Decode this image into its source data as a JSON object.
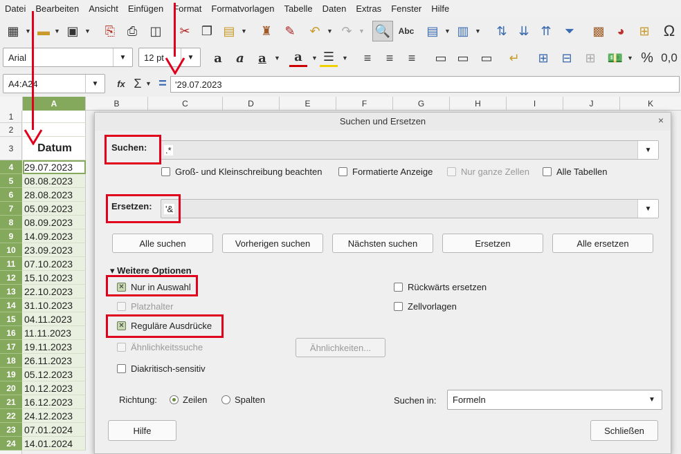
{
  "menu": [
    "Datei",
    "Bearbeiten",
    "Ansicht",
    "Einfügen",
    "Format",
    "Formatvorlagen",
    "Tabelle",
    "Daten",
    "Extras",
    "Fenster",
    "Hilfe"
  ],
  "toolbar": {
    "font_name": "Arial",
    "font_size": "12 pt",
    "percent_label": "%",
    "number_label": "0,0"
  },
  "formula_bar": {
    "name_box": "A4:A24",
    "content": "'29.07.2023",
    "func_icon_label": "fx",
    "sum_label": "Σ",
    "equals_label": "="
  },
  "sheet": {
    "columns": [
      "A",
      "B",
      "C",
      "D",
      "E",
      "F",
      "G",
      "H",
      "I",
      "J",
      "K"
    ],
    "rows": [
      "1",
      "2",
      "3",
      "4",
      "5",
      "6",
      "7",
      "8",
      "9",
      "10",
      "11",
      "12",
      "13",
      "14",
      "15",
      "16",
      "17",
      "18",
      "19",
      "20",
      "21",
      "22",
      "23",
      "24"
    ],
    "header_cell": "Datum",
    "dates": [
      "29.07.2023",
      "08.08.2023",
      "28.08.2023",
      "05.09.2023",
      "08.09.2023",
      "14.09.2023",
      "23.09.2023",
      "07.10.2023",
      "15.10.2023",
      "22.10.2023",
      "31.10.2023",
      "04.11.2023",
      "11.11.2023",
      "19.11.2023",
      "26.11.2023",
      "05.12.2023",
      "10.12.2023",
      "16.12.2023",
      "24.12.2023",
      "07.01.2024",
      "14.01.2024"
    ]
  },
  "dialog": {
    "title": "Suchen und Ersetzen",
    "close": "×",
    "search_label": "Suchen:",
    "search_value": ".*",
    "replace_label": "Ersetzen:",
    "replace_value": "'&",
    "options_top": [
      {
        "label": "Groß- und Kleinschreibung beachten",
        "checked": false,
        "disabled": false
      },
      {
        "label": "Formatierte Anzeige",
        "checked": false,
        "disabled": false
      },
      {
        "label": "Nur ganze Zellen",
        "checked": false,
        "disabled": true
      },
      {
        "label": "Alle Tabellen",
        "checked": false,
        "disabled": false
      }
    ],
    "buttons": [
      "Alle suchen",
      "Vorherigen suchen",
      "Nächsten suchen",
      "Ersetzen",
      "Alle ersetzen"
    ],
    "more_options": "Weitere Optionen",
    "opt_selection": "Nur in Auswahl",
    "opt_wildcards": "Platzhalter",
    "opt_regex": "Reguläre Ausdrücke",
    "opt_similarity": "Ähnlichkeitssuche",
    "similarities_button": "Ähnlichkeiten...",
    "opt_diacritics": "Diakritisch-sensitiv",
    "opt_backwards": "Rückwärts ersetzen",
    "opt_cellstyles": "Zellvorlagen",
    "direction_label": "Richtung:",
    "direction_rows": "Zeilen",
    "direction_cols": "Spalten",
    "search_in_label": "Suchen in:",
    "search_in_value": "Formeln",
    "help_button": "Hilfe",
    "close_button": "Schließen"
  },
  "colors": {
    "annotation_red": "#e0001b",
    "selection_green": "#84a95c"
  }
}
